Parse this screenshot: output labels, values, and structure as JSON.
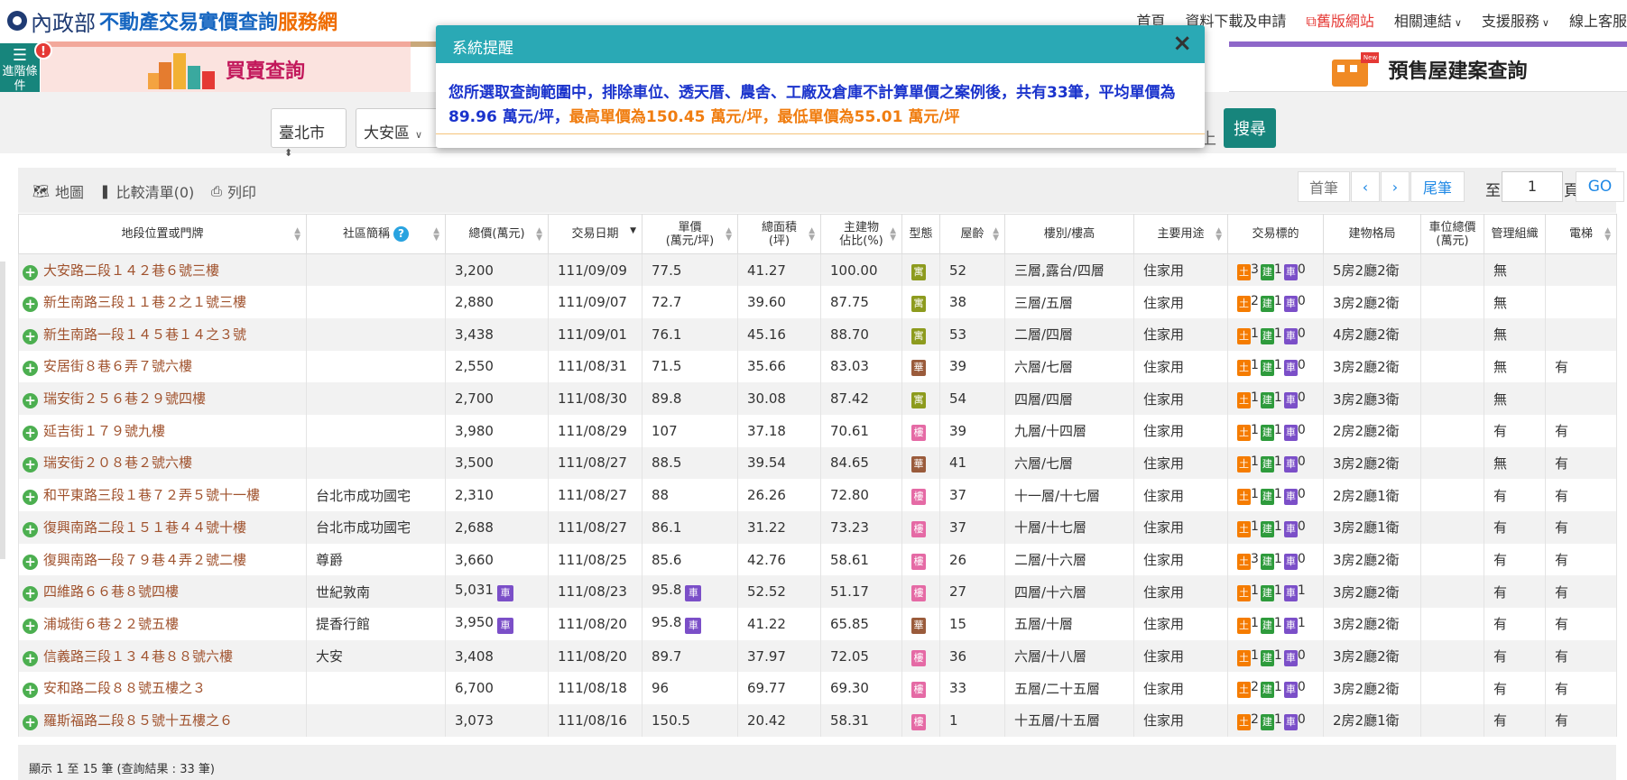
{
  "header": {
    "org": "內政部",
    "site_name_blue": "不動產交易實價查詢",
    "site_name_orange": "服務網",
    "nav": [
      "首頁",
      "資料下載及申請",
      "舊版網站",
      "相關連結",
      "支援服務",
      "線上客服"
    ]
  },
  "tabs": {
    "buy": "買賣查詢",
    "presale": "預售屋建案查詢",
    "presale_badge": "New"
  },
  "advanced": {
    "label": "進階條件",
    "badge": "!"
  },
  "search": {
    "city": "臺北市",
    "district": "大安區",
    "behind_text": "上",
    "button": "搜尋"
  },
  "toolbar": {
    "map": "地圖",
    "compare": "比較清單(0)",
    "print": "列印"
  },
  "pager": {
    "first": "首筆",
    "prev": "‹",
    "next": "›",
    "last": "尾筆",
    "to": "至",
    "page": "1",
    "unit": "頁",
    "go": "GO"
  },
  "table": {
    "headers": [
      {
        "label": "地段位置或門牌"
      },
      {
        "label": "社區簡稱"
      },
      {
        "label": "總價(萬元)"
      },
      {
        "label": "交易日期"
      },
      {
        "label": "單價\n(萬元/坪)"
      },
      {
        "label": "總面積\n(坪)"
      },
      {
        "label": "主建物\n佔比(%)"
      },
      {
        "label": "型態"
      },
      {
        "label": "屋齡"
      },
      {
        "label": "樓別/樓高"
      },
      {
        "label": "主要用途"
      },
      {
        "label": "交易標的"
      },
      {
        "label": "建物格局"
      },
      {
        "label": "車位總價\n(萬元)"
      },
      {
        "label": "管理組織"
      },
      {
        "label": "電梯"
      }
    ],
    "rows": [
      {
        "addr": "大安路二段１４２巷６號三樓",
        "community": "",
        "total": "3,200",
        "total_park": false,
        "date": "111/09/09",
        "unit": "77.5",
        "unit_park": false,
        "area": "41.27",
        "main_pct": "100.00",
        "type": "寓",
        "age": "52",
        "floor": "三層,露台/四層",
        "use": "住家用",
        "land": "3",
        "bldg": "1",
        "park": "0",
        "layout": "5房2廳2衛",
        "mgmt": "無",
        "elevator": ""
      },
      {
        "addr": "新生南路三段１１巷２之１號三樓",
        "community": "",
        "total": "2,880",
        "total_park": false,
        "date": "111/09/07",
        "unit": "72.7",
        "unit_park": false,
        "area": "39.60",
        "main_pct": "87.75",
        "type": "寓",
        "age": "38",
        "floor": "三層/五層",
        "use": "住家用",
        "land": "2",
        "bldg": "1",
        "park": "0",
        "layout": "3房2廳2衛",
        "mgmt": "無",
        "elevator": ""
      },
      {
        "addr": "新生南路一段１４５巷１４之３號",
        "community": "",
        "total": "3,438",
        "total_park": false,
        "date": "111/09/01",
        "unit": "76.1",
        "unit_park": false,
        "area": "45.16",
        "main_pct": "88.70",
        "type": "寓",
        "age": "53",
        "floor": "二層/四層",
        "use": "住家用",
        "land": "1",
        "bldg": "1",
        "park": "0",
        "layout": "4房2廳2衛",
        "mgmt": "無",
        "elevator": ""
      },
      {
        "addr": "安居街８巷６弄７號六樓",
        "community": "",
        "total": "2,550",
        "total_park": false,
        "date": "111/08/31",
        "unit": "71.5",
        "unit_park": false,
        "area": "35.66",
        "main_pct": "83.03",
        "type": "華",
        "age": "39",
        "floor": "六層/七層",
        "use": "住家用",
        "land": "1",
        "bldg": "1",
        "park": "0",
        "layout": "3房2廳2衛",
        "mgmt": "無",
        "elevator": "有"
      },
      {
        "addr": "瑞安街２５６巷２９號四樓",
        "community": "",
        "total": "2,700",
        "total_park": false,
        "date": "111/08/30",
        "unit": "89.8",
        "unit_park": false,
        "area": "30.08",
        "main_pct": "87.42",
        "type": "寓",
        "age": "54",
        "floor": "四層/四層",
        "use": "住家用",
        "land": "1",
        "bldg": "1",
        "park": "0",
        "layout": "3房2廳3衛",
        "mgmt": "無",
        "elevator": ""
      },
      {
        "addr": "延吉街１７９號九樓",
        "community": "",
        "total": "3,980",
        "total_park": false,
        "date": "111/08/29",
        "unit": "107",
        "unit_park": false,
        "area": "37.18",
        "main_pct": "70.61",
        "type": "樓",
        "age": "39",
        "floor": "九層/十四層",
        "use": "住家用",
        "land": "1",
        "bldg": "1",
        "park": "0",
        "layout": "2房2廳2衛",
        "mgmt": "有",
        "elevator": "有"
      },
      {
        "addr": "瑞安街２０８巷２號六樓",
        "community": "",
        "total": "3,500",
        "total_park": false,
        "date": "111/08/27",
        "unit": "88.5",
        "unit_park": false,
        "area": "39.54",
        "main_pct": "84.65",
        "type": "華",
        "age": "41",
        "floor": "六層/七層",
        "use": "住家用",
        "land": "1",
        "bldg": "1",
        "park": "0",
        "layout": "3房2廳2衛",
        "mgmt": "無",
        "elevator": "有"
      },
      {
        "addr": "和平東路三段１巷７２弄５號十一樓",
        "community": "台北市成功國宅",
        "total": "2,310",
        "total_park": false,
        "date": "111/08/27",
        "unit": "88",
        "unit_park": false,
        "area": "26.26",
        "main_pct": "72.80",
        "type": "樓",
        "age": "37",
        "floor": "十一層/十七層",
        "use": "住家用",
        "land": "1",
        "bldg": "1",
        "park": "0",
        "layout": "2房2廳1衛",
        "mgmt": "有",
        "elevator": "有"
      },
      {
        "addr": "復興南路二段１５１巷４４號十樓",
        "community": "台北市成功國宅",
        "total": "2,688",
        "total_park": false,
        "date": "111/08/27",
        "unit": "86.1",
        "unit_park": false,
        "area": "31.22",
        "main_pct": "73.23",
        "type": "樓",
        "age": "37",
        "floor": "十層/十七層",
        "use": "住家用",
        "land": "1",
        "bldg": "1",
        "park": "0",
        "layout": "3房2廳1衛",
        "mgmt": "有",
        "elevator": "有"
      },
      {
        "addr": "復興南路一段７９巷４弄２號二樓",
        "community": "尊爵",
        "total": "3,660",
        "total_park": false,
        "date": "111/08/25",
        "unit": "85.6",
        "unit_park": false,
        "area": "42.76",
        "main_pct": "58.61",
        "type": "樓",
        "age": "26",
        "floor": "二層/十六層",
        "use": "住家用",
        "land": "3",
        "bldg": "1",
        "park": "0",
        "layout": "3房2廳2衛",
        "mgmt": "有",
        "elevator": "有"
      },
      {
        "addr": "四維路６６巷８號四樓",
        "community": "世紀敦南",
        "total": "5,031",
        "total_park": true,
        "date": "111/08/23",
        "unit": "95.8",
        "unit_park": true,
        "area": "52.52",
        "main_pct": "51.17",
        "type": "樓",
        "age": "27",
        "floor": "四層/十六層",
        "use": "住家用",
        "land": "1",
        "bldg": "1",
        "park": "1",
        "layout": "3房2廳2衛",
        "mgmt": "有",
        "elevator": "有"
      },
      {
        "addr": "浦城街６巷２２號五樓",
        "community": "提香行館",
        "total": "3,950",
        "total_park": true,
        "date": "111/08/20",
        "unit": "95.8",
        "unit_park": true,
        "area": "41.22",
        "main_pct": "65.85",
        "type": "華",
        "age": "15",
        "floor": "五層/十層",
        "use": "住家用",
        "land": "1",
        "bldg": "1",
        "park": "1",
        "layout": "3房2廳2衛",
        "mgmt": "有",
        "elevator": "有"
      },
      {
        "addr": "信義路三段１３４巷８８號六樓",
        "community": "大安",
        "total": "3,408",
        "total_park": false,
        "date": "111/08/20",
        "unit": "89.7",
        "unit_park": false,
        "area": "37.97",
        "main_pct": "72.05",
        "type": "樓",
        "age": "36",
        "floor": "六層/十八層",
        "use": "住家用",
        "land": "1",
        "bldg": "1",
        "park": "0",
        "layout": "3房2廳2衛",
        "mgmt": "有",
        "elevator": "有"
      },
      {
        "addr": "安和路二段８８號五樓之３",
        "community": "",
        "total": "6,700",
        "total_park": false,
        "date": "111/08/18",
        "unit": "96",
        "unit_park": false,
        "area": "69.77",
        "main_pct": "69.30",
        "type": "樓",
        "age": "33",
        "floor": "五層/二十五層",
        "use": "住家用",
        "land": "2",
        "bldg": "1",
        "park": "0",
        "layout": "3房2廳2衛",
        "mgmt": "有",
        "elevator": "有"
      },
      {
        "addr": "羅斯福路二段８５號十五樓之６",
        "community": "",
        "total": "3,073",
        "total_park": false,
        "date": "111/08/16",
        "unit": "150.5",
        "unit_park": false,
        "area": "20.42",
        "main_pct": "58.31",
        "type": "樓",
        "age": "1",
        "floor": "十五層/十五層",
        "use": "住家用",
        "land": "2",
        "bldg": "1",
        "park": "0",
        "layout": "2房2廳1衛",
        "mgmt": "有",
        "elevator": "有"
      }
    ],
    "target_labels": {
      "land": "土",
      "bldg": "建",
      "park": "車"
    },
    "park_badge": "車"
  },
  "footer": {
    "summary": "顯示 1 至 15 筆 (查詢結果 : 33 筆)"
  },
  "modal": {
    "title": "系統提醒",
    "close": "×",
    "msg_blue": "您所選取查詢範圍中，排除車位、透天厝、農舍、工廠及倉庫不計算單價之案例後，共有33筆，平均單價為89.96 萬元/坪，",
    "msg_orange": "最高單價為150.45 萬元/坪，最低單價為55.01 萬元/坪"
  },
  "colors": {
    "teal": "#17857c",
    "modal_header": "#2aa9b5",
    "address": "#a0522d",
    "msg_blue": "#1a33cc",
    "msg_orange": "#f07d10"
  }
}
